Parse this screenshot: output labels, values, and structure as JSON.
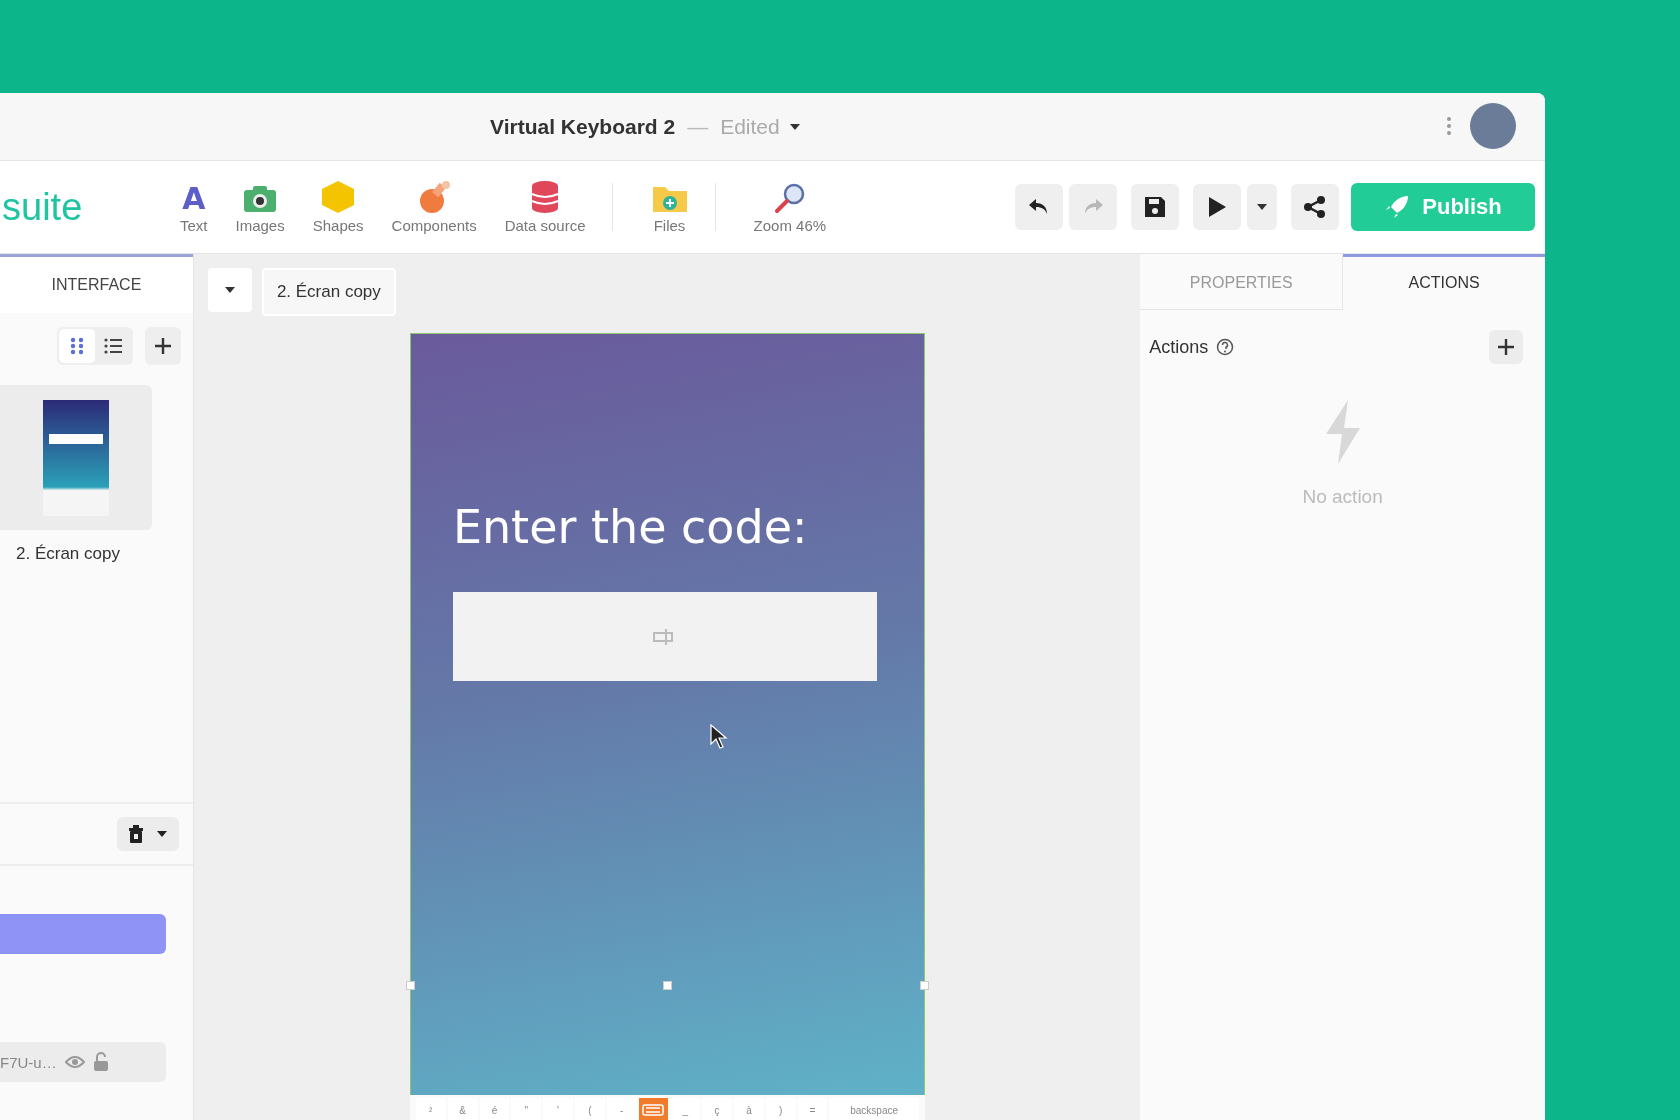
{
  "window": {
    "title": "Virtual Keyboard 2",
    "separator": "—",
    "status": "Edited"
  },
  "toolbar": {
    "logo": "suite",
    "tools": [
      {
        "kind": "text",
        "glyph": "A",
        "label": "Text"
      },
      {
        "kind": "images",
        "label": "Images"
      },
      {
        "kind": "shapes",
        "label": "Shapes"
      },
      {
        "kind": "components",
        "label": "Components"
      },
      {
        "kind": "datasource",
        "label": "Data source"
      },
      {
        "kind": "files",
        "label": "Files"
      },
      {
        "kind": "zoom",
        "label": "Zoom 46%"
      }
    ],
    "actions": [
      {
        "kind": "undo",
        "disabled": false
      },
      {
        "kind": "redo",
        "disabled": true
      },
      {
        "kind": "save",
        "disabled": false
      },
      {
        "kind": "play",
        "disabled": false
      },
      {
        "kind": "share",
        "disabled": false
      }
    ],
    "publish": "Publish"
  },
  "left_panel": {
    "tab": "INTERFACE",
    "views": [
      {
        "kind": "grid",
        "selected": true
      },
      {
        "kind": "list",
        "selected": false
      }
    ],
    "screens": [
      {
        "label": "2. Écran copy",
        "selected": true
      }
    ],
    "layer": "F7U-u…"
  },
  "canvas": {
    "screen_tab": "2. Écran copy",
    "heading": "Enter the code:",
    "keys": [
      {
        "kind": "char",
        "label": "²"
      },
      {
        "kind": "char",
        "label": "&"
      },
      {
        "kind": "char",
        "label": "é"
      },
      {
        "kind": "char",
        "label": "\""
      },
      {
        "kind": "char",
        "label": "'"
      },
      {
        "kind": "char",
        "label": "("
      },
      {
        "kind": "char",
        "label": "-"
      },
      {
        "kind": "icon"
      },
      {
        "kind": "char",
        "label": "_"
      },
      {
        "kind": "char",
        "label": "ç"
      },
      {
        "kind": "char",
        "label": "à"
      },
      {
        "kind": "char",
        "label": ")"
      },
      {
        "kind": "char",
        "label": "="
      },
      {
        "kind": "wide",
        "label": "backspace"
      }
    ]
  },
  "right_panel": {
    "tabs": [
      {
        "label": "PROPERTIES",
        "selected": false
      },
      {
        "label": "ACTIONS",
        "selected": true
      }
    ],
    "section": "Actions",
    "empty_message": "No action"
  }
}
